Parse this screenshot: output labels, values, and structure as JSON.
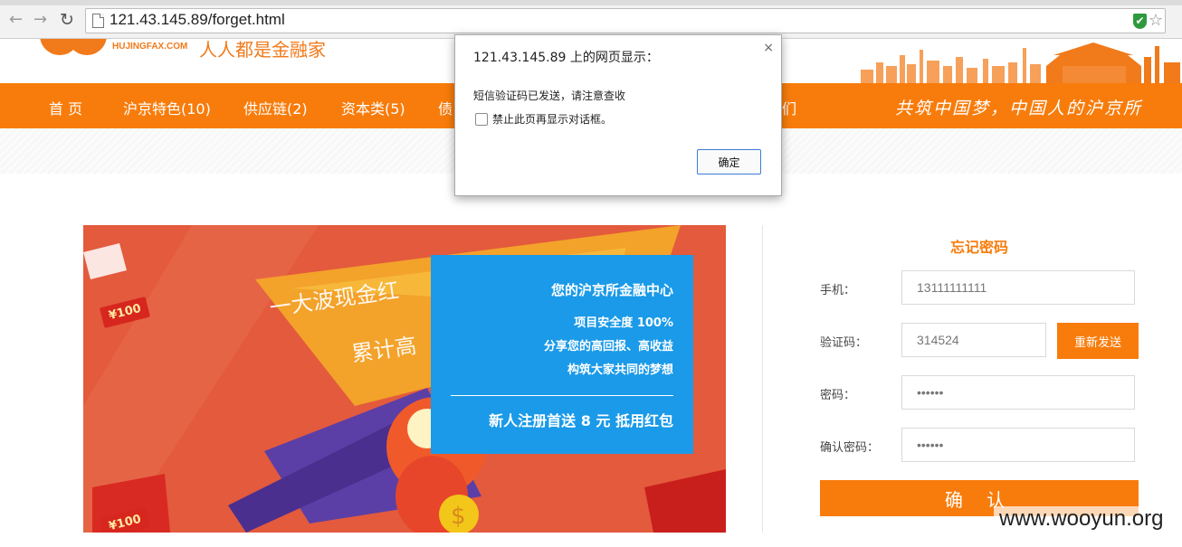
{
  "browser": {
    "url": "121.43.145.89/forget.html",
    "back_icon": "←",
    "forward_icon": "→",
    "reload_icon": "↻",
    "shield_icon": "✔",
    "star_icon": "☆"
  },
  "header": {
    "logo_url": "HUJINGFAX.COM",
    "slogan": "人人都是金融家"
  },
  "nav": {
    "items": [
      "首 页",
      "沪京特色(10)",
      "供应链(2)",
      "资本类(5)",
      "债",
      "们"
    ],
    "motto": "共筑中国梦，中国人的沪京所"
  },
  "banner": {
    "headline_1": "一大波现金红",
    "headline_2": "累计高",
    "tag_1": "¥100",
    "tag_2": "¥100",
    "card_title": "您的沪京所金融中心",
    "card_lines": [
      "项目安全度 100%",
      "分享您的高回报、高收益",
      "构筑大家共同的梦想"
    ],
    "card_promo": "新人注册首送 8 元 抵用红包"
  },
  "form": {
    "title": "忘记密码",
    "phone_label": "手机：",
    "phone_value": "13111111111",
    "code_label": "验证码：",
    "code_value": "314524",
    "resend_label": "重新发送",
    "password_label": "密码：",
    "password_value": "••••••",
    "confirm_password_label": "确认密码：",
    "confirm_password_value": "••••••",
    "submit_label": "确 认"
  },
  "dialog": {
    "title": "121.43.145.89 上的网页显示：",
    "close_icon": "×",
    "message": "短信验证码已发送，请注意查收",
    "checkbox_label": "禁止此页再显示对话框。",
    "ok_label": "确定"
  },
  "watermark": "www.wooyun.org",
  "colors": {
    "brand_orange": "#f87c0b",
    "card_blue": "#1a9ae8",
    "banner_red": "#e0553a"
  }
}
